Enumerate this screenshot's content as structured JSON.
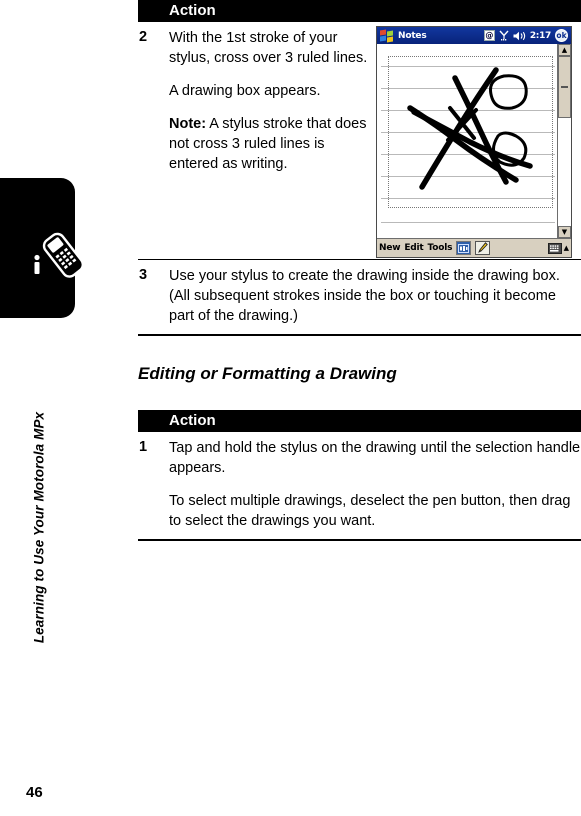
{
  "page": {
    "number": "46",
    "running_head": "Learning to Use Your Motorola MPx",
    "phone_icon": "mobile-phone-icon",
    "info_icon": "info-icon"
  },
  "table1": {
    "header": {
      "num": "",
      "label": "Action"
    },
    "rows": [
      {
        "num": "2",
        "paragraphs": [
          "With the 1st stroke of your stylus, cross over 3 ruled lines.",
          "A drawing box appears.",
          "Note: A stylus stroke that does not cross 3 ruled lines is entered as writing."
        ],
        "note_lead": "Note:",
        "note_rest": " A stylus stroke that does not cross 3 ruled lines is entered as writing.",
        "has_screenshot": true
      },
      {
        "num": "3",
        "paragraphs": [
          "Use your stylus to create the drawing inside the drawing box. (All subsequent strokes inside the box or touching it become part of the drawing.)"
        ],
        "has_screenshot": false
      }
    ]
  },
  "section_title": "Editing or Formatting a Drawing",
  "table2": {
    "header": {
      "num": "",
      "label": "Action"
    },
    "rows": [
      {
        "num": "1",
        "paragraphs": [
          "Tap and hold the stylus on the drawing until the selection handle appears.",
          "To select multiple drawings, deselect the pen button, then drag to select the drawings you want."
        ],
        "has_screenshot": false
      }
    ]
  },
  "pda_screenshot": {
    "titlebar": {
      "logo": "windows-logo-icon",
      "app_title": "Notes",
      "status_icons": [
        "screen-rotate-icon",
        "signal-icon",
        "volume-icon"
      ],
      "time": "2:17",
      "ok_button": "ok"
    },
    "canvas": {
      "drawing": "tic-tac-toe-sketch",
      "selection_box": true,
      "ruled_lines": 8
    },
    "scrollbar": {
      "up": "▲",
      "down": "▼",
      "thumb": "scroll-thumb"
    },
    "toolbar": {
      "menus": [
        "New",
        "Edit",
        "Tools"
      ],
      "buttons": [
        "recording-icon",
        "pen-icon"
      ],
      "pen_active": true,
      "right_buttons": [
        "keyboard-icon",
        "input-panel-chevron"
      ]
    }
  },
  "colors": {
    "titlebar_blue": "#0b2d8f",
    "toolbar_beige": "#d8d0c0",
    "header_black": "#000000",
    "rule_gray": "#b9b9b9"
  }
}
